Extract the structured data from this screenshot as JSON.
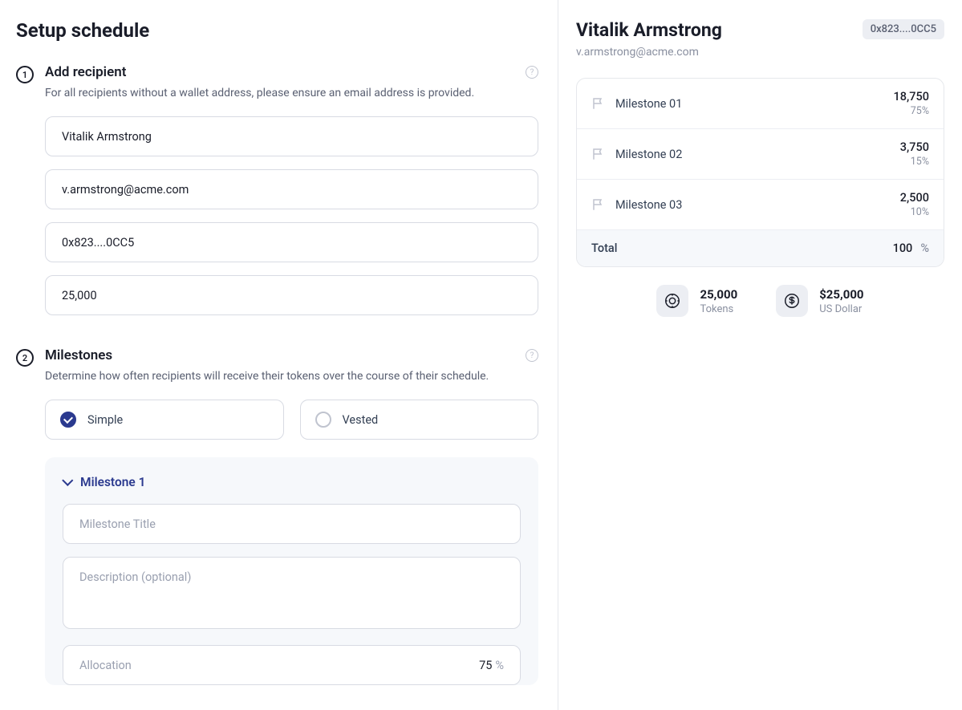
{
  "page_title": "Setup schedule",
  "section1": {
    "step": "1",
    "title": "Add recipient",
    "desc": "For all recipients without a wallet address, please ensure an email address is provided.",
    "fields": {
      "name": "Vitalik Armstrong",
      "email": "v.armstrong@acme.com",
      "wallet": "0x823....0CC5",
      "amount": "25,000"
    }
  },
  "section2": {
    "step": "2",
    "title": "Milestones",
    "desc": "Determine how often recipients will receive their tokens over the course of their schedule.",
    "options": {
      "simple": "Simple",
      "vested": "Vested"
    },
    "milestone_panel": {
      "heading": "Milestone 1",
      "title_placeholder": "Milestone Title",
      "desc_placeholder": "Description (optional)",
      "allocation_label": "Allocation",
      "allocation_value": "75",
      "allocation_unit": "%"
    }
  },
  "summary": {
    "name": "Vitalik Armstrong",
    "wallet": "0x823....0CC5",
    "email": "v.armstrong@acme.com",
    "milestones": [
      {
        "name": "Milestone 01",
        "amount": "18,750",
        "pct": "75%"
      },
      {
        "name": "Milestone 02",
        "amount": "3,750",
        "pct": "15%"
      },
      {
        "name": "Milestone 03",
        "amount": "2,500",
        "pct": "10%"
      }
    ],
    "total_label": "Total",
    "total_value": "100",
    "total_unit": "%",
    "totals": {
      "tokens": {
        "value": "25,000",
        "label": "Tokens"
      },
      "usd": {
        "value": "$25,000",
        "label": "US Dollar"
      }
    }
  }
}
